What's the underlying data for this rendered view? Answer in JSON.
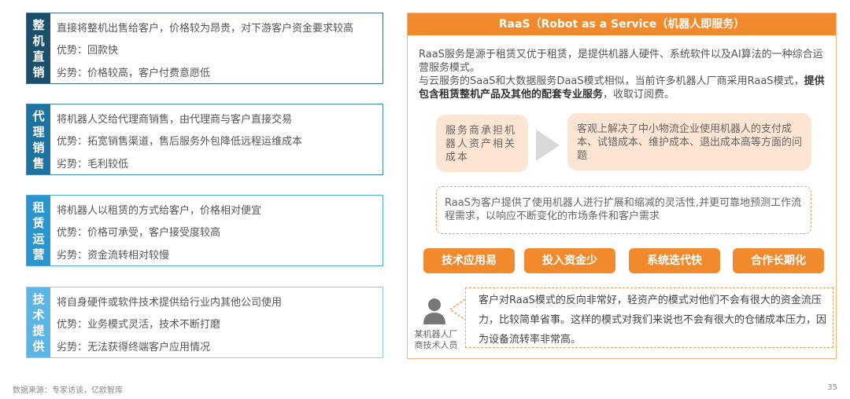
{
  "models": [
    {
      "tag": [
        "整",
        "机",
        "直",
        "销"
      ],
      "color": "#1b4f6b",
      "border": "#3d6f8a",
      "desc": "直接将整机出售给客户，价格较为昂贵，对下游客户资金要求较高",
      "pro": "优势：回款快",
      "con": "劣势：价格较高，客户付费意愿低"
    },
    {
      "tag": [
        "代",
        "理",
        "销",
        "售"
      ],
      "color": "#1f73a0",
      "border": "#3d8cb8",
      "desc": "将机器人交给代理商销售，由代理商与客户直接交易",
      "pro": "优势：拓宽销售渠道，售后服务外包降低远程运维成本",
      "con": "劣势：毛利较低"
    },
    {
      "tag": [
        "租",
        "赁",
        "运",
        "营"
      ],
      "color": "#2b95cf",
      "border": "#4aa8dc",
      "desc": "将机器人以租赁的方式给客户，价格相对便宜",
      "pro": "优势：价格可承受，客户接受度较高",
      "con": "劣势：资金流转相对较慢"
    },
    {
      "tag": [
        "技",
        "术",
        "提",
        "供"
      ],
      "color": "#5db5e3",
      "border": "#8ccbec",
      "desc": "将自身硬件或软件技术提供给行业内其他公司使用",
      "pro": "优势：业务模式灵活，技术不断打磨",
      "con": "劣势：无法获得终端客户应用情况"
    }
  ],
  "raas": {
    "title": "RaaS（Robot as a Service（机器人即服务）",
    "intro1": "RaaS服务是源于租赁又优于租赁，是提供机器人硬件、系统软件以及AI算法的一种综合运营服务模式。",
    "intro2": "与云服务的SaaS和大数据服务DaaS模式相似，当前许多机器人厂商采用RaaS模式，",
    "intro3_bold": "提供包含租赁整机产品及其他的配套专业服务",
    "intro3_rest": "，收取订阅费。",
    "cost_left": "服务商承担机器人资产相关成本",
    "cost_right": "客观上解决了中小物流企业使用机器人的支付成本、试错成本、维护成本、退出成本高等方面的问题",
    "flex_text": "RaaS为客户提供了使用机器人进行扩展和缩减的灵活性,并更可靠地预测工作流程需求，以响应不断变化的市场条件和客户需求",
    "benefits": [
      "技术应用易",
      "投入资金少",
      "系统迭代快",
      "合作长期化"
    ],
    "quote": "客户对RaaS模式的反向非常好，轻资产的模式对他们不会有很大的资金流压力，比较简单省事。这样的模式对我们来说也不会有很大的仓储成本压力，因为设备流转率非常高。",
    "speaker": "某机器人厂商技术人员",
    "accent": "#f08a2c"
  },
  "footer": {
    "source": "数据来源：专家访谈，亿欧智库",
    "page": "35"
  }
}
